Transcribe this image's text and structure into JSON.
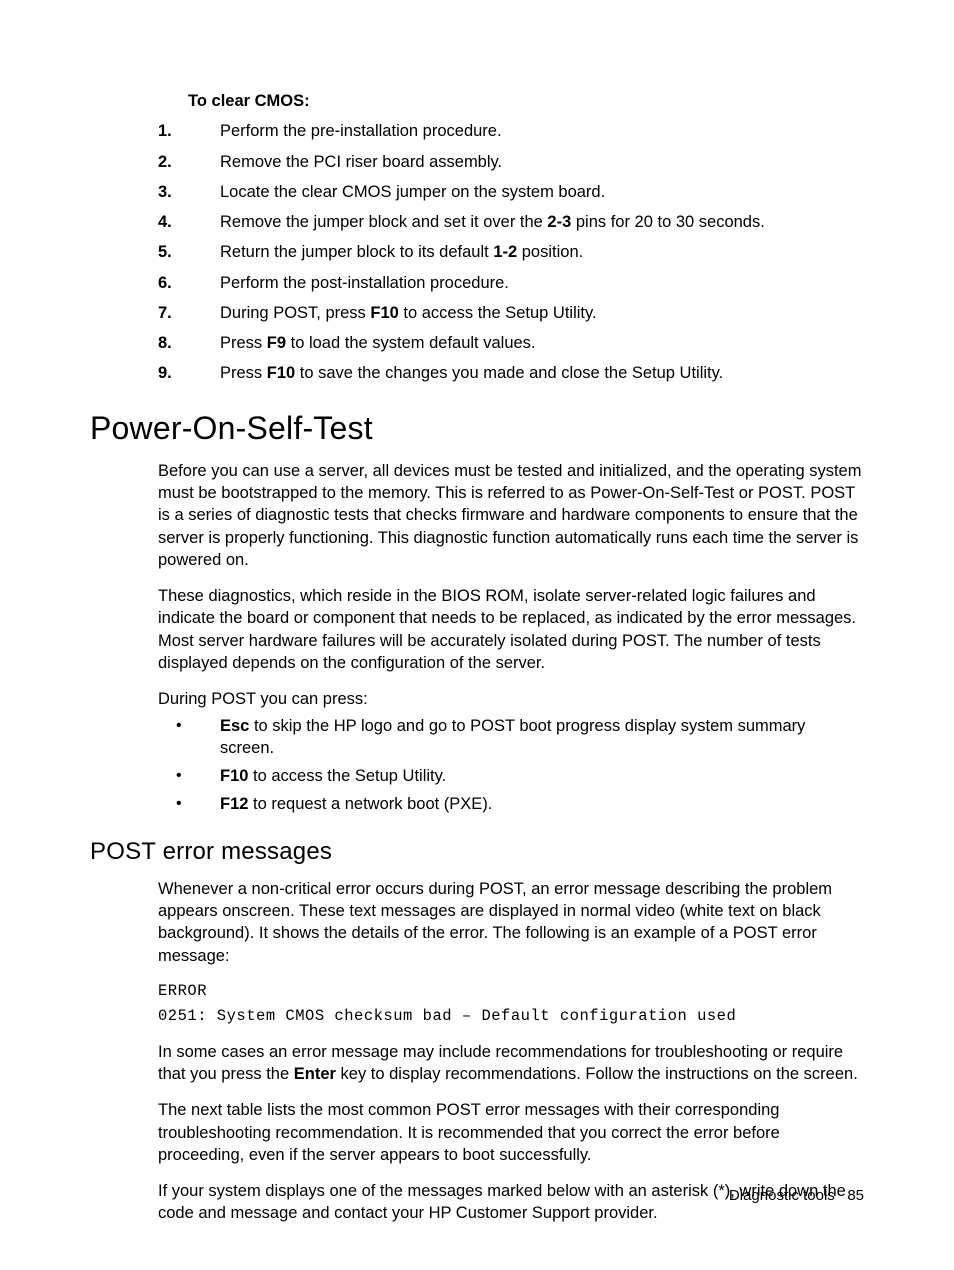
{
  "cmos": {
    "heading": "To clear CMOS:",
    "steps": [
      {
        "n": "1.",
        "pre": "",
        "text": "Perform the pre-installation procedure."
      },
      {
        "n": "2.",
        "pre": "",
        "text": "Remove the PCI riser board assembly."
      },
      {
        "n": "3.",
        "pre": "",
        "text": "Locate the clear CMOS jumper on the system board."
      },
      {
        "n": "4.",
        "pre": "Remove the jumper block and set it over the ",
        "bold": "2-3",
        "post": " pins for 20 to 30 seconds."
      },
      {
        "n": "5.",
        "pre": "Return the jumper block to its default ",
        "bold": "1-2",
        "post": " position."
      },
      {
        "n": "6.",
        "pre": "",
        "text": "Perform the post-installation procedure."
      },
      {
        "n": "7.",
        "pre": "During POST, press ",
        "bold": "F10",
        "post": " to access the Setup Utility."
      },
      {
        "n": "8.",
        "pre": "Press ",
        "bold": "F9",
        "post": " to load the system default values."
      },
      {
        "n": "9.",
        "pre": "Press ",
        "bold": "F10",
        "post": " to save the changes you made and close the Setup Utility."
      }
    ]
  },
  "post": {
    "title": "Power-On-Self-Test",
    "para1": "Before you can use a server, all devices must be tested and initialized, and the operating system must be bootstrapped to the memory. This is referred to as Power-On-Self-Test or POST. POST is a series of diagnostic tests that checks firmware and hardware components to ensure that the server is properly functioning. This diagnostic function automatically runs each time the server is powered on.",
    "para2": "These diagnostics, which reside in the BIOS ROM, isolate server-related logic failures and indicate the board or component that needs to be replaced, as indicated by the error messages. Most server hardware failures will be accurately isolated during POST. The number of tests displayed depends on the configuration of the server.",
    "para3": "During POST you can press:",
    "keys": [
      {
        "bold": "Esc",
        "rest": " to skip the HP logo and go to POST boot progress display system summary screen."
      },
      {
        "bold": "F10",
        "rest": " to access the Setup Utility."
      },
      {
        "bold": "F12",
        "rest": " to request a network boot (PXE)."
      }
    ]
  },
  "errors": {
    "title": "POST error messages",
    "para1": "Whenever a non-critical error occurs during POST, an error message describing the problem appears onscreen. These text messages are displayed in normal video (white text on black background). It shows the details of the error. The following is an example of a POST error message:",
    "code1": "ERROR",
    "code2": "0251: System CMOS checksum bad – Default configuration used",
    "para2a": "In some cases an error message may include recommendations for troubleshooting or require that you press the ",
    "para2bold": "Enter",
    "para2b": " key to display recommendations. Follow the instructions on the screen.",
    "para3": "The next table lists the most common POST error messages with their corresponding troubleshooting recommendation. It is recommended that you correct the error before proceeding, even if the server appears to boot successfully.",
    "para4": "If your system displays one of the messages marked below with an asterisk (*), write down the code and message and contact your HP Customer Support provider."
  },
  "footer": {
    "section": "Diagnostic tools",
    "page": "85"
  }
}
